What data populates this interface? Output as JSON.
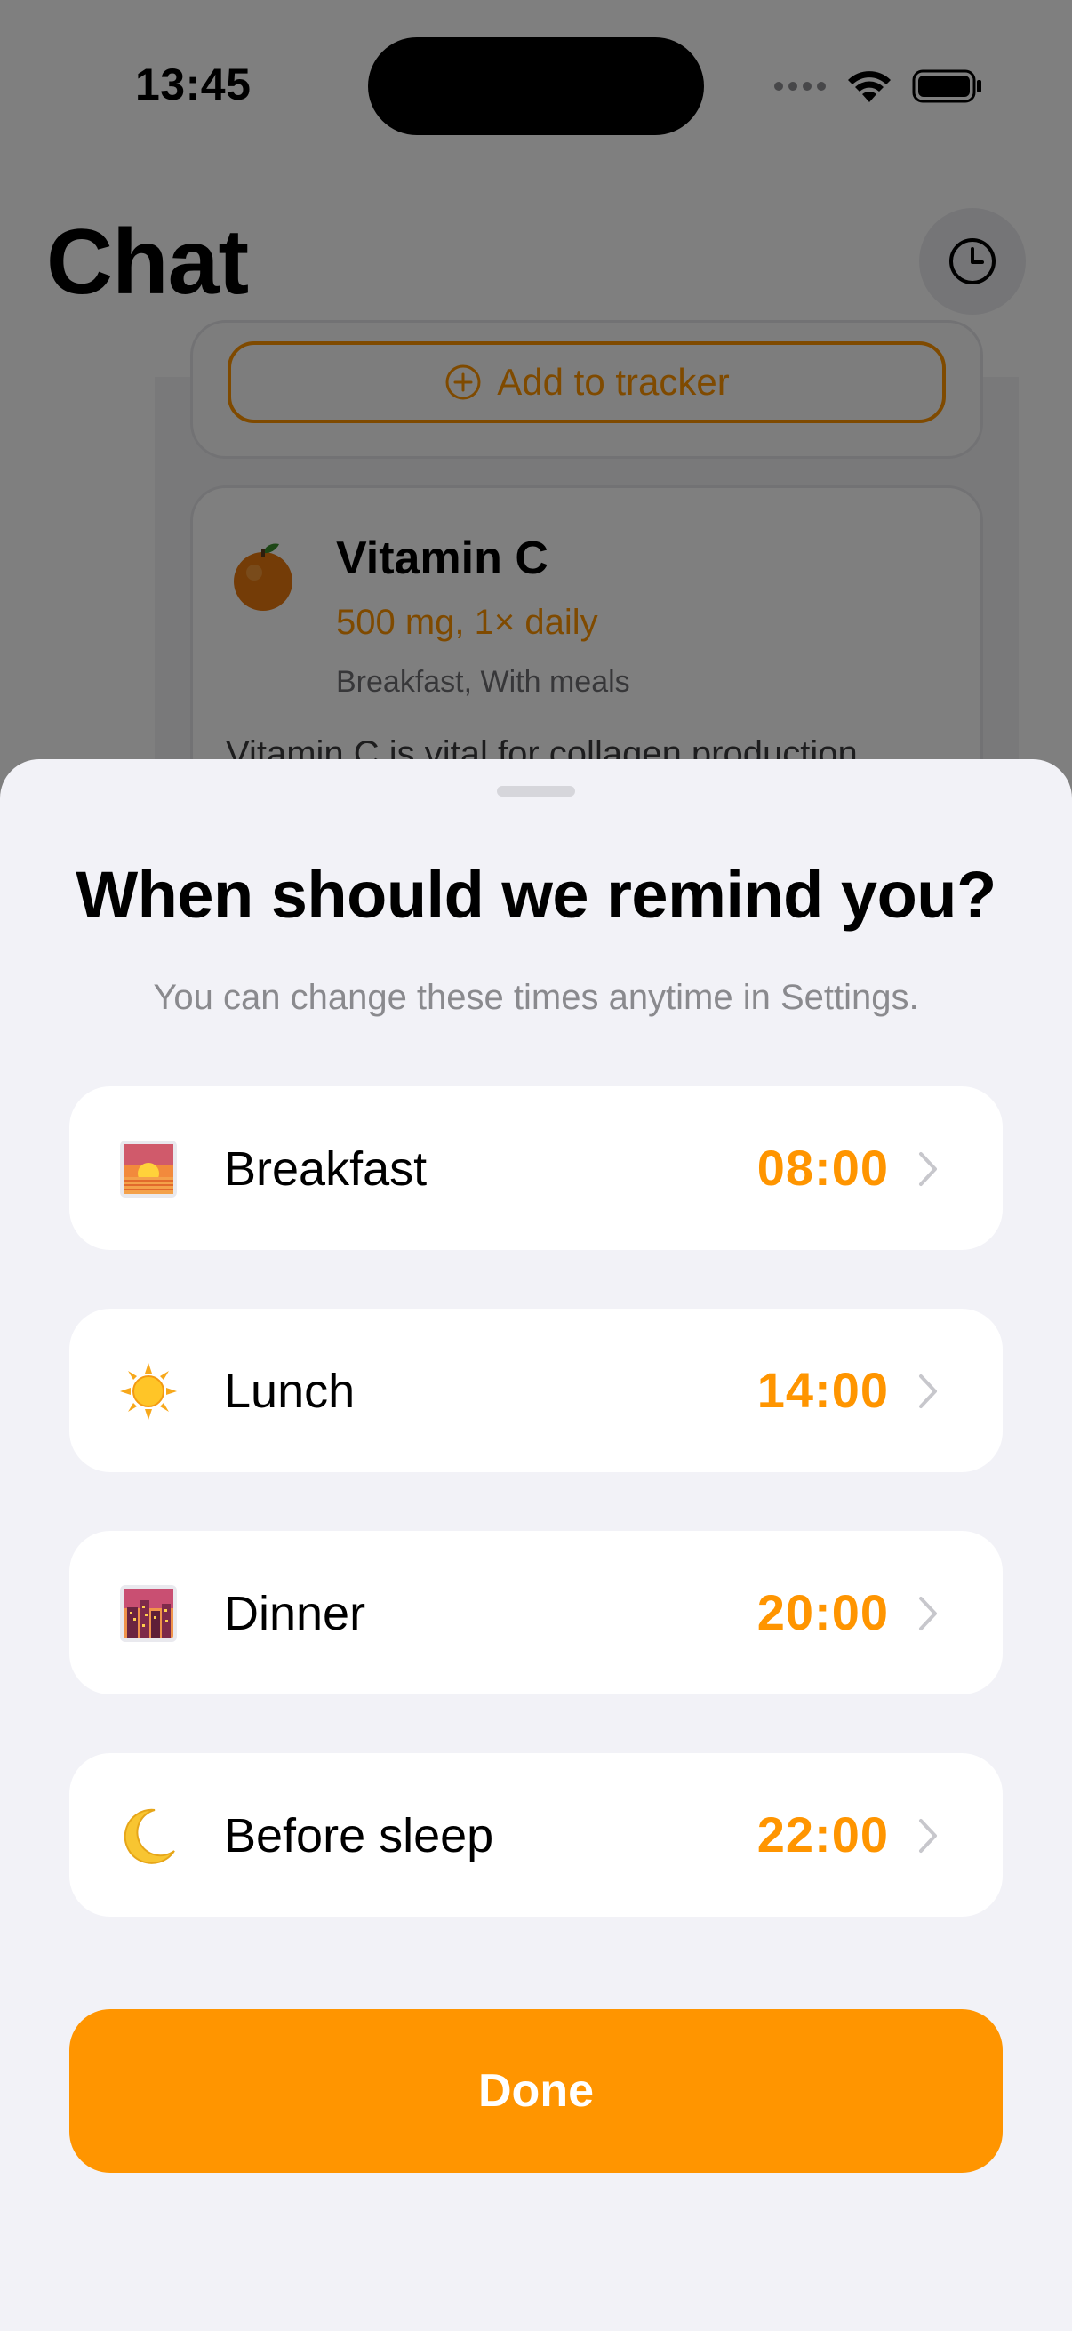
{
  "status_bar": {
    "time": "13:45"
  },
  "background": {
    "title": "Chat",
    "add_to_tracker_label": "Add to tracker",
    "supplement": {
      "name": "Vitamin C",
      "dose": "500 mg, 1× daily",
      "timing": "Breakfast, With meals",
      "description": "Vitamin C is vital for collagen production"
    }
  },
  "sheet": {
    "title": "When should we remind you?",
    "subtitle": "You can change these times anytime in Settings.",
    "reminders": [
      {
        "label": "Breakfast",
        "time": "08:00",
        "icon": "sunrise-icon"
      },
      {
        "label": "Lunch",
        "time": "14:00",
        "icon": "sun-icon"
      },
      {
        "label": "Dinner",
        "time": "20:00",
        "icon": "city-dusk-icon"
      },
      {
        "label": "Before sleep",
        "time": "22:00",
        "icon": "crescent-moon-icon"
      }
    ],
    "done_label": "Done"
  },
  "colors": {
    "accent": "#ff9500",
    "sheet_background": "#f2f2f7",
    "secondary_text": "#8a8a8e"
  }
}
